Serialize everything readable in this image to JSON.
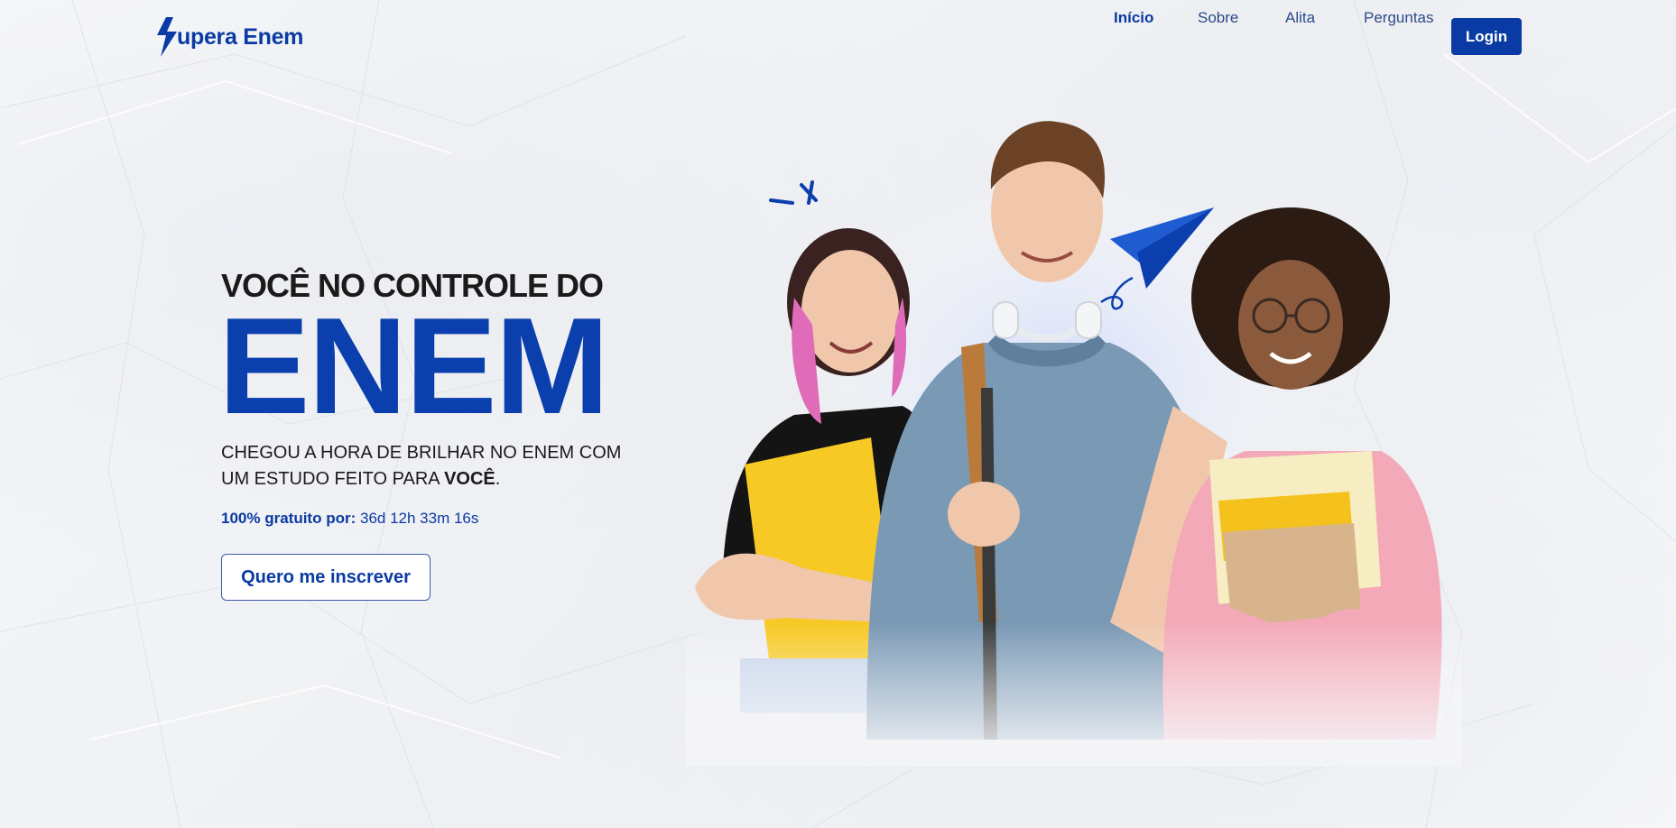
{
  "brand": {
    "logo_text": "upera Enem",
    "logo_icon": "lightning-bolt-icon",
    "color": "#0a3aa3"
  },
  "nav": {
    "items": [
      {
        "label": "Início",
        "active": true
      },
      {
        "label": "Sobre",
        "active": false
      },
      {
        "label": "Alita",
        "active": false
      },
      {
        "label": "Perguntas",
        "active": false
      }
    ],
    "login_label": "Login"
  },
  "hero": {
    "kicker": "VOCÊ NO CONTROLE DO",
    "title": "ENEM",
    "subtitle_line1": "CHEGOU A HORA DE BRILHAR NO ENEM COM",
    "subtitle_line2_prefix": "UM ESTUDO FEITO PARA ",
    "subtitle_line2_bold": "VOCÊ",
    "subtitle_line2_suffix": ".",
    "countdown_label": "100% gratuito por:",
    "countdown_value": "36d 12h 33m 16s",
    "cta_label": "Quero me inscrever"
  },
  "colors": {
    "accent": "#0a3aa3",
    "title_blue": "#0a3fad",
    "text_dark": "#1a1a1a"
  },
  "illustration": {
    "subject": "three-students-photo",
    "decorations": [
      "paper-plane-icon",
      "spark-lines-icon"
    ]
  }
}
